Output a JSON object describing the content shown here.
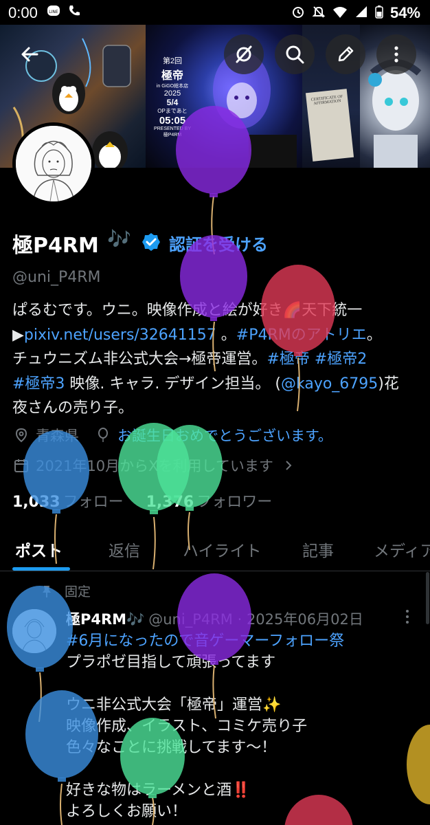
{
  "status_bar": {
    "time": "0:00",
    "battery": "54%",
    "left_icons": [
      "line-app-icon",
      "phone-icon"
    ],
    "right_icons": [
      "alarm-icon",
      "mute-icon",
      "wifi-icon",
      "signal-icon",
      "battery-icon"
    ]
  },
  "banner": {
    "poster_lines": [
      "第2回",
      "極帝",
      "in GiGO総本店",
      "2025",
      "5/4",
      "OPまであと",
      "05:05",
      "PRESENTED BY",
      "極P4RM"
    ],
    "certificate_text": "CERTIFICATE OF AFFIRMATION"
  },
  "profile": {
    "display_name": "極P4RM",
    "name_emoji": "🎶",
    "verify_label": "認証を受ける",
    "handle": "@uni_P4RM",
    "bio": {
      "line1": "ぱるむです。ウニ。映像作成と絵が好き🌈天下統一",
      "line2_prefix": "▶",
      "line2_link": "pixiv.net/users/32641157",
      "line2_mid": " 。",
      "line2_tag": "#P4RMのアトリエ",
      "line2_suffix": "。",
      "line3_text": "チュウニズム非公式大会→極帝運営。",
      "line3_tag1": "#極帝",
      "line3_tag2": "#極帝2",
      "line4_tag": "#極帝3",
      "line4_text": " 映像. キャラ. デザイン担当。 (",
      "line4_mention": "@kayo_6795",
      "line4_suffix": ")花",
      "line5": "夜さんの売り子。"
    },
    "location": "青森県",
    "birthday": "お誕生日おめでとうございます。",
    "joined": "2021年10月からXを利用しています",
    "following_count": "1,033",
    "following_label": "フォロー",
    "followers_count": "1,376",
    "followers_label": "フォロワー"
  },
  "tabs": [
    "ポスト",
    "返信",
    "ハイライト",
    "記事",
    "メディア"
  ],
  "pinned_post": {
    "pinned_label": "固定",
    "author": "極P4RM",
    "author_emoji": "🎶",
    "handle_date": "@uni_P4RM · 2025年06月02日",
    "lines": [
      "#6月になったので音ゲーマーフォロー祭",
      "プラポゼ目指して頑張ってます",
      "",
      "ウニ非公式大会「極帝」運営✨",
      "映像作成、イラスト、コミケ売り子",
      "色々なことに挑戦してます〜！",
      "",
      "好きな物はラーメンと酒‼️",
      "よろしくお願い！"
    ]
  },
  "balloons": [
    {
      "color": "#8a2be2"
    },
    {
      "color": "#8a2be2"
    },
    {
      "color": "#e03a56"
    },
    {
      "color": "#3b8fe0"
    },
    {
      "color": "#4ee39a"
    },
    {
      "color": "#4ee39a"
    },
    {
      "color": "#8a2be2"
    },
    {
      "color": "#3b8fe0"
    },
    {
      "color": "#3b8fe0"
    },
    {
      "color": "#4ee39a"
    },
    {
      "color": "#e0b42a"
    },
    {
      "color": "#e03a56"
    }
  ],
  "colors": {
    "link": "#4da3ff",
    "accent": "#1d9bf0",
    "muted": "#71767b",
    "background": "#000000"
  }
}
